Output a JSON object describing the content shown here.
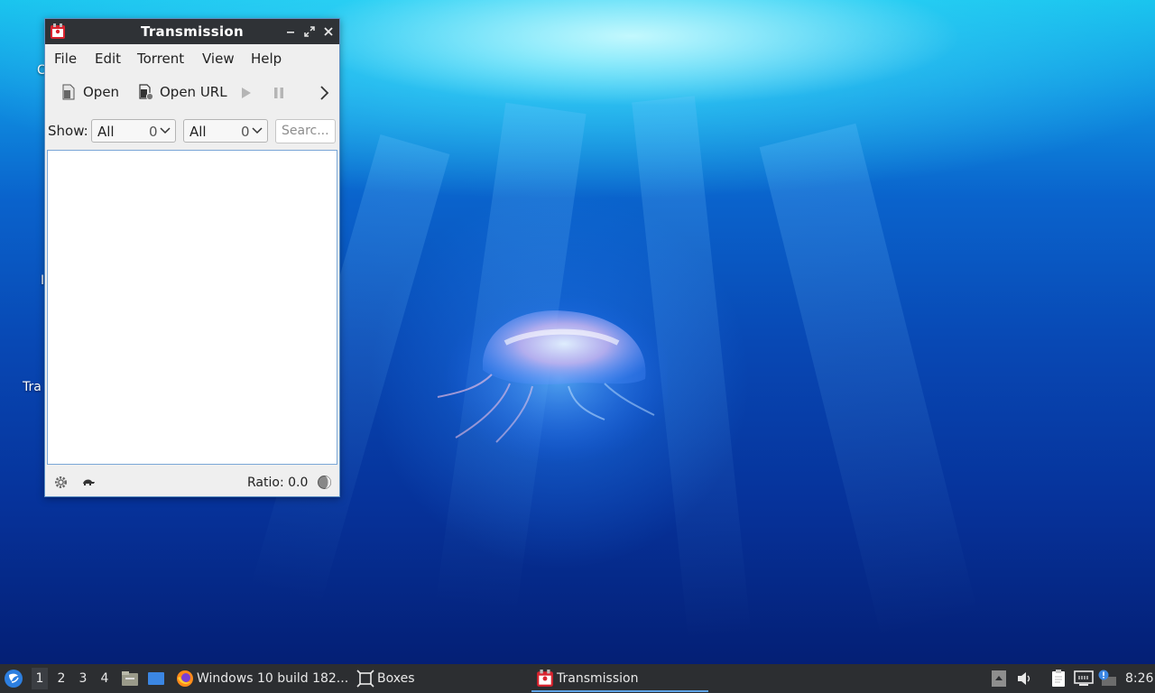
{
  "desktop": {
    "icon_labels": [
      "C",
      "I",
      "Tra"
    ]
  },
  "window": {
    "title": "Transmission",
    "controls": [
      "minimize",
      "maximize",
      "close"
    ],
    "menu": [
      "File",
      "Edit",
      "Torrent",
      "View",
      "Help"
    ],
    "toolbar": {
      "open_label": "Open",
      "open_url_label": "Open URL"
    },
    "filter": {
      "show_label": "Show:",
      "activity_value": "All",
      "activity_count": "0",
      "tracker_value": "All",
      "tracker_count": "0",
      "search_placeholder": "Searc..."
    },
    "status": {
      "ratio": "Ratio: 0.0"
    }
  },
  "taskbar": {
    "workspaces": [
      "1",
      "2",
      "3",
      "4"
    ],
    "active_workspace": "1",
    "tasks": {
      "firefox": "Windows 10 build 182...",
      "boxes": "Boxes",
      "transmission": "Transmission"
    },
    "clock": "8:26"
  },
  "colors": {
    "titlebar": "#2f3236",
    "taskbar": "#2c2e31",
    "accent": "#5fa3e6",
    "transmission_red": "#d9232e"
  }
}
